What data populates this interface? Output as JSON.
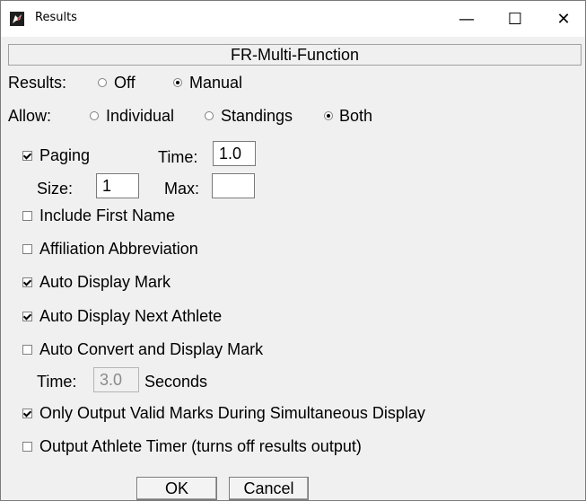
{
  "window": {
    "title": "Results",
    "minimize_glyph": "—",
    "maximize_glyph": "☐",
    "close_glyph": "✕"
  },
  "section": {
    "title": "FR-Multi-Function"
  },
  "results": {
    "label": "Results:",
    "options": [
      {
        "label": "Off",
        "selected": false
      },
      {
        "label": "Manual",
        "selected": true
      }
    ]
  },
  "allow": {
    "label": "Allow:",
    "options": [
      {
        "label": "Individual",
        "selected": false
      },
      {
        "label": "Standings",
        "selected": false
      },
      {
        "label": "Both",
        "selected": true
      }
    ]
  },
  "paging": {
    "label": "Paging",
    "checked": true,
    "time_label": "Time:",
    "time_value": "1.0",
    "size_label": "Size:",
    "size_value": "1",
    "max_label": "Max:",
    "max_value": ""
  },
  "checkboxes": [
    {
      "label": "Include First Name",
      "checked": false
    },
    {
      "label": "Affiliation Abbreviation",
      "checked": false
    },
    {
      "label": "Auto Display Mark",
      "checked": true
    },
    {
      "label": "Auto Display Next Athlete",
      "checked": true
    },
    {
      "label": "Auto Convert and Display Mark",
      "checked": false
    }
  ],
  "convert_time": {
    "label": "Time:",
    "value": "3.0",
    "unit": "Seconds"
  },
  "only_valid": {
    "label": "Only Output Valid Marks During Simultaneous Display",
    "checked": true
  },
  "athlete_timer": {
    "label": "Output Athlete Timer (turns off results output)",
    "checked": false
  },
  "buttons": {
    "ok": "OK",
    "cancel": "Cancel"
  }
}
